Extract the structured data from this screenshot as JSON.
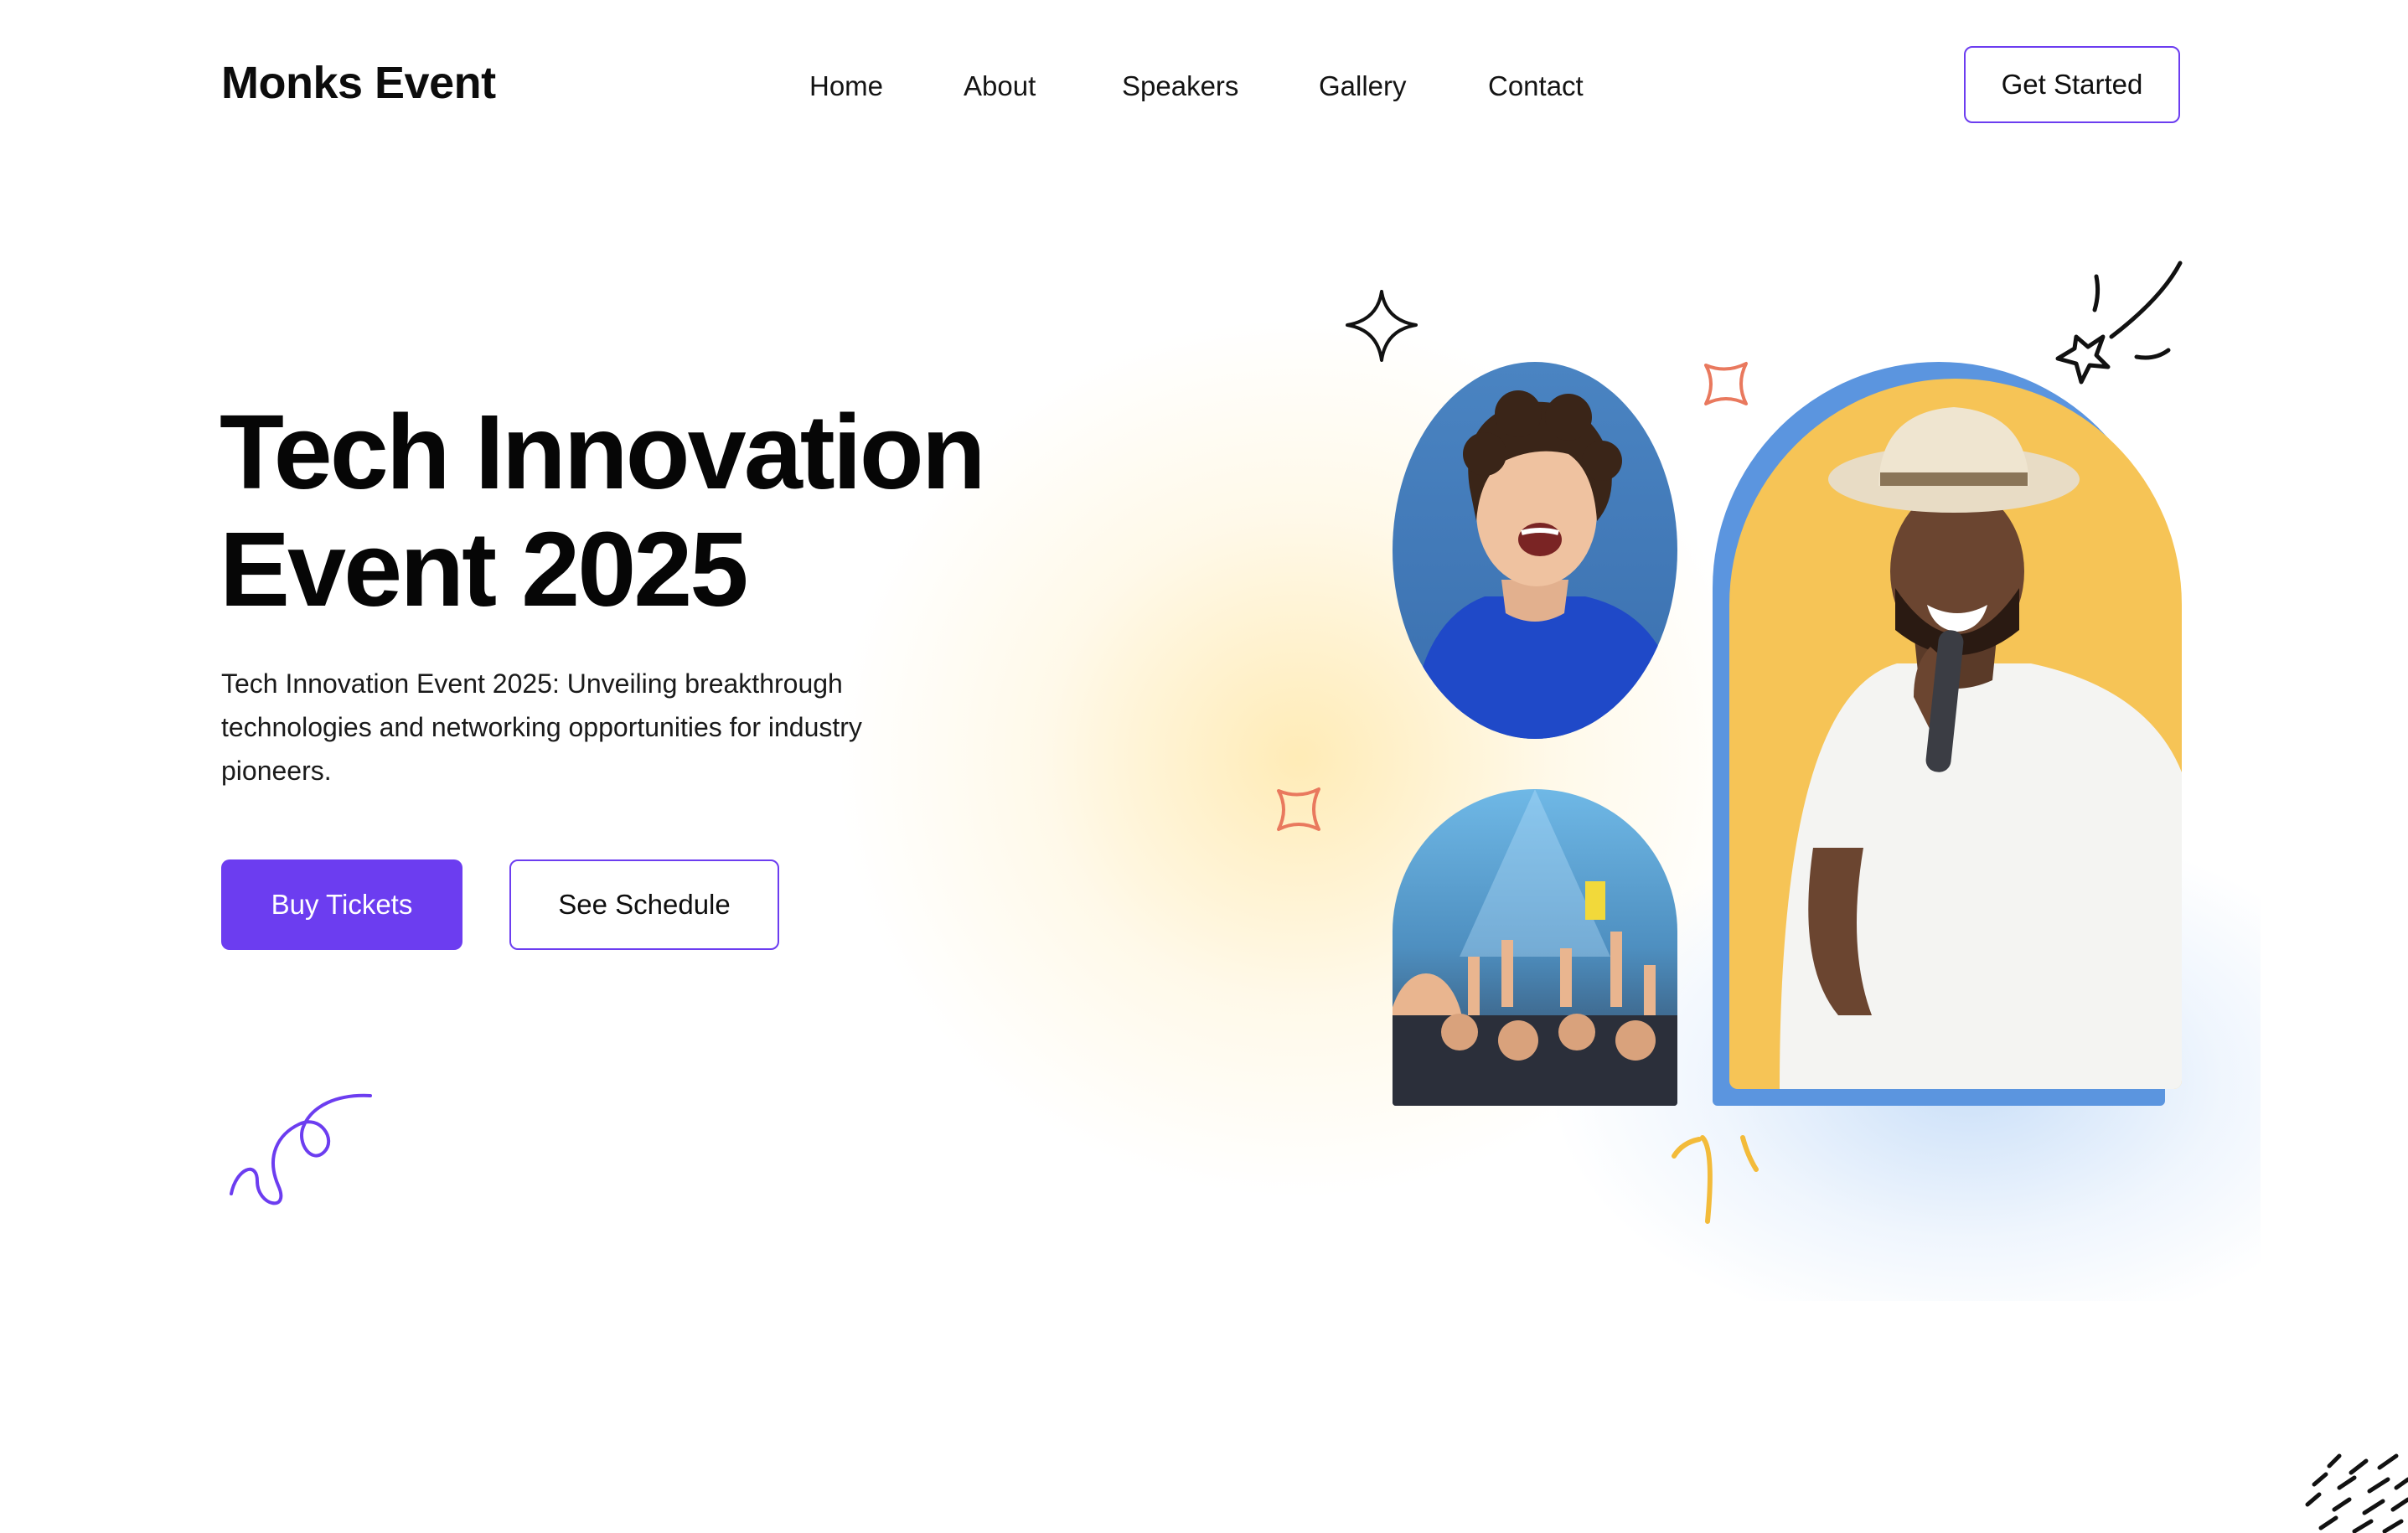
{
  "header": {
    "logo": "Monks Event",
    "nav": [
      {
        "label": "Home"
      },
      {
        "label": "About"
      },
      {
        "label": "Speakers"
      },
      {
        "label": "Gallery"
      },
      {
        "label": "Contact"
      }
    ],
    "cta_label": "Get Started"
  },
  "hero": {
    "title_line1": "Tech Innovation",
    "title_line2": "Event 2025",
    "description": "Tech Innovation Event 2025: Unveiling breakthrough technologies and networking opportunities for industry pioneers.",
    "buy_label": "Buy Tickets",
    "schedule_label": "See Schedule"
  },
  "colors": {
    "accent": "#6c3df0",
    "arch_blue": "#5b95df",
    "arch_yellow": "#f6c456",
    "sparkle_orange": "#e9795e",
    "burst_yellow": "#f3bb3a"
  },
  "icons": [
    "sparkle-outline-icon",
    "sparkle-orange-icon",
    "shooting-star-icon",
    "squiggle-icon",
    "burst-icon",
    "dash-pattern-icon"
  ]
}
